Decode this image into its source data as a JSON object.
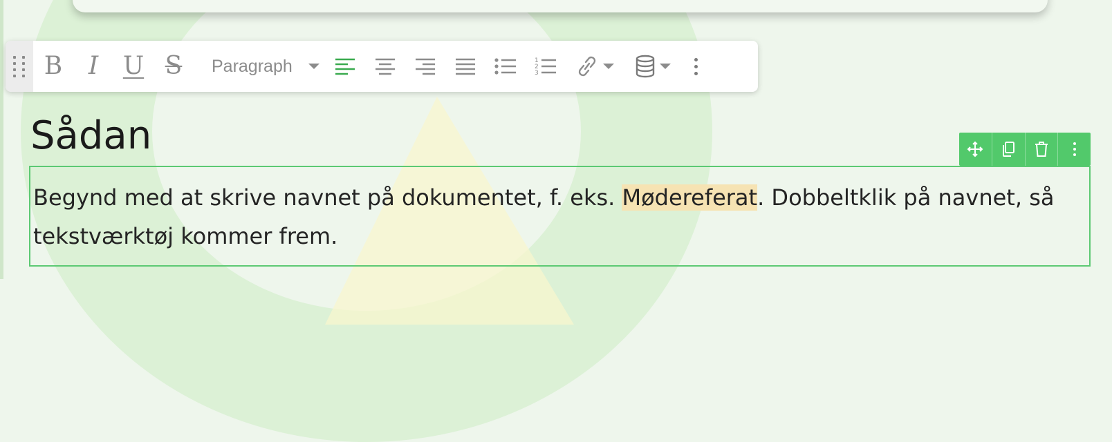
{
  "toolbar": {
    "bold_label": "B",
    "italic_label": "I",
    "underline_label": "U",
    "strike_label": "S",
    "paragraph_label": "Paragraph",
    "icons": [
      "drag-handle-icon",
      "align-left-icon",
      "align-center-icon",
      "align-right-icon",
      "align-justify-icon",
      "bullet-list-icon",
      "numbered-list-icon",
      "link-icon",
      "database-icon",
      "more-vertical-icon"
    ]
  },
  "heading": "Sådan",
  "block_actions": [
    "move-icon",
    "copy-icon",
    "trash-icon",
    "more-vertical-icon"
  ],
  "text": {
    "before": "Begynd med at skrive navnet på dokumentet, f. eks. ",
    "highlight": "Mødereferat",
    "after": ". Dobbeltklik på navnet, så tekstværktøj kommer frem."
  },
  "colors": {
    "accent_green": "#52c96b",
    "highlight": "#f6e3b3",
    "toolbar_icon": "#8c8c8c"
  }
}
